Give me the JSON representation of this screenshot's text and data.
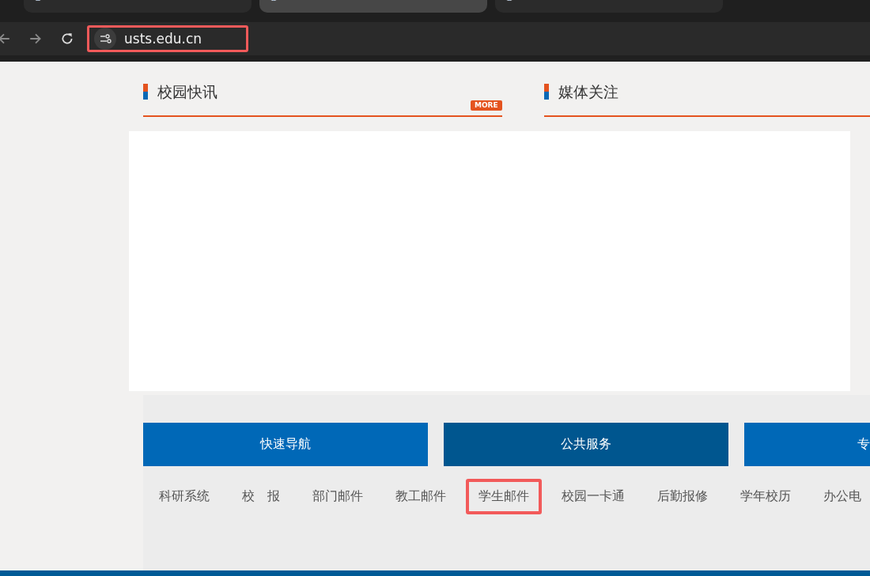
{
  "browser": {
    "tabs": [
      {
        "selected": false
      },
      {
        "selected": true
      },
      {
        "selected": false
      }
    ],
    "address": {
      "value": "usts.edu.cn",
      "highlighted": true
    }
  },
  "sections": [
    {
      "title": "校园快讯",
      "more": "MORE"
    },
    {
      "title": "媒体关注"
    }
  ],
  "service_tabs": [
    {
      "label": "快速导航",
      "selected": false
    },
    {
      "label": "公共服务",
      "selected": true
    },
    {
      "label": "专",
      "selected": false
    }
  ],
  "links": [
    {
      "label": "科研系统",
      "highlighted": false
    },
    {
      "label": "校　报",
      "highlighted": false
    },
    {
      "label": "部门邮件",
      "highlighted": false
    },
    {
      "label": "教工邮件",
      "highlighted": false
    },
    {
      "label": "学生邮件",
      "highlighted": true
    },
    {
      "label": "校园一卡通",
      "highlighted": false
    },
    {
      "label": "后勤报修",
      "highlighted": false
    },
    {
      "label": "学年校历",
      "highlighted": false
    },
    {
      "label": "办公电",
      "highlighted": false
    }
  ]
}
